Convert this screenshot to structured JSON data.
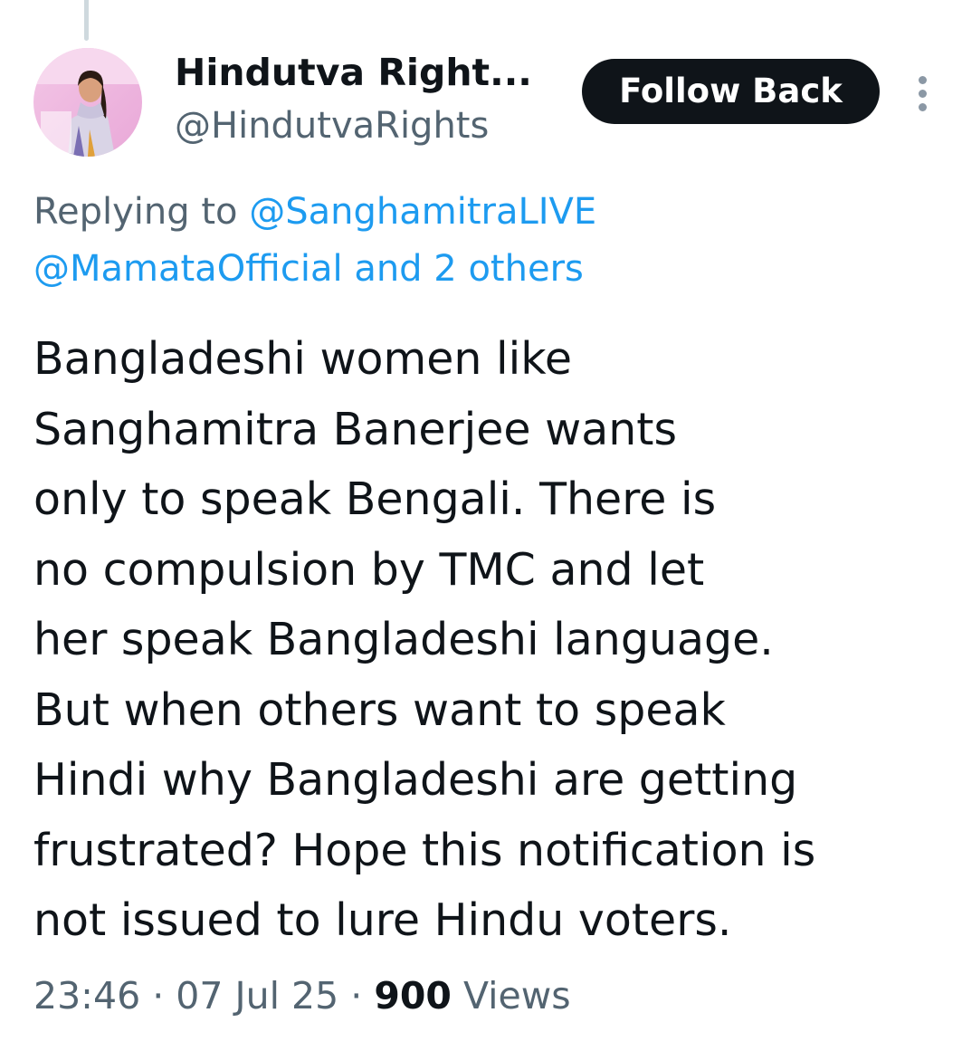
{
  "author": {
    "display_name": "Hindutva Right...",
    "handle": "@HindutvaRights"
  },
  "follow_button": {
    "label": "Follow Back"
  },
  "more_menu": {
    "icon": "more-vertical-icon"
  },
  "reply_context": {
    "prefix": "Replying to",
    "mention_1": "@SanghamitraLIVE",
    "mention_2": "@MamataOfficial",
    "others": "and 2 others"
  },
  "tweet": {
    "lines": [
      "Bangladeshi women like",
      "Sanghamitra Banerjee wants",
      "only to speak Bengali. There is",
      "no compulsion by TMC and let",
      "her speak Bangladeshi language.",
      "But when others want to speak",
      "Hindi why Bangladeshi are getting",
      "frustrated? Hope this notification is",
      "not issued to lure Hindu voters."
    ]
  },
  "meta": {
    "time": "23:46",
    "date": "07 Jul 25",
    "separator": "·",
    "views_count": "900",
    "views_label": "Views"
  },
  "colors": {
    "text_primary": "#0f1419",
    "text_secondary": "#536471",
    "link": "#1d9bf0",
    "button_bg": "#0f1419",
    "button_text": "#ffffff",
    "thread_line": "#cfd9de"
  }
}
